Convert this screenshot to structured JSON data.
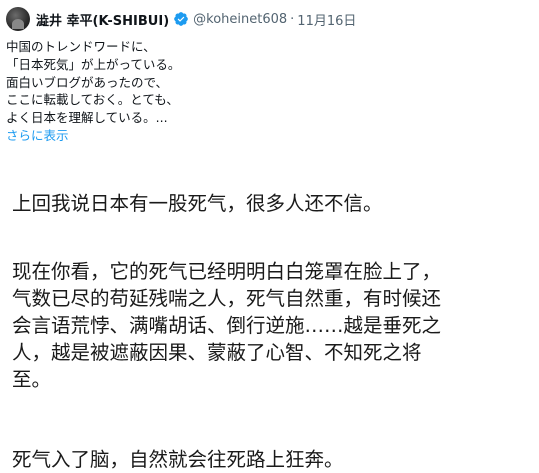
{
  "tweet": {
    "display_name": "澁井 幸平(K-SHIBUI)",
    "handle": "@koheinet608",
    "separator": "·",
    "date": "11月16日",
    "lines": [
      "中国のトレンドワードに、",
      "「日本死気」が上がっている。",
      "面白いブログがあったので、",
      "ここに転載しておく。とても、",
      "よく日本を理解している。..."
    ],
    "show_more": "さらに表示"
  },
  "article": {
    "para1": "上回我说日本有一股死气，很多人还不信。",
    "para2_lines": [
      "现在你看，它的死气已经明明白白笼罩在脸上了，",
      "气数已尽的苟延残喘之人，死气自然重，有时候还",
      "会言语荒悖、满嘴胡话、倒行逆施……越是垂死之",
      "人，越是被遮蔽因果、蒙蔽了心智、不知死之将",
      "至。"
    ],
    "para3": "死气入了脑，自然就会往死路上狂奔。"
  },
  "colors": {
    "text": "#0f1419",
    "muted": "#536471",
    "link": "#1d9bf0",
    "verified_badge": "#1d9bf0"
  },
  "icons": {
    "verified": "verified-badge-icon"
  }
}
